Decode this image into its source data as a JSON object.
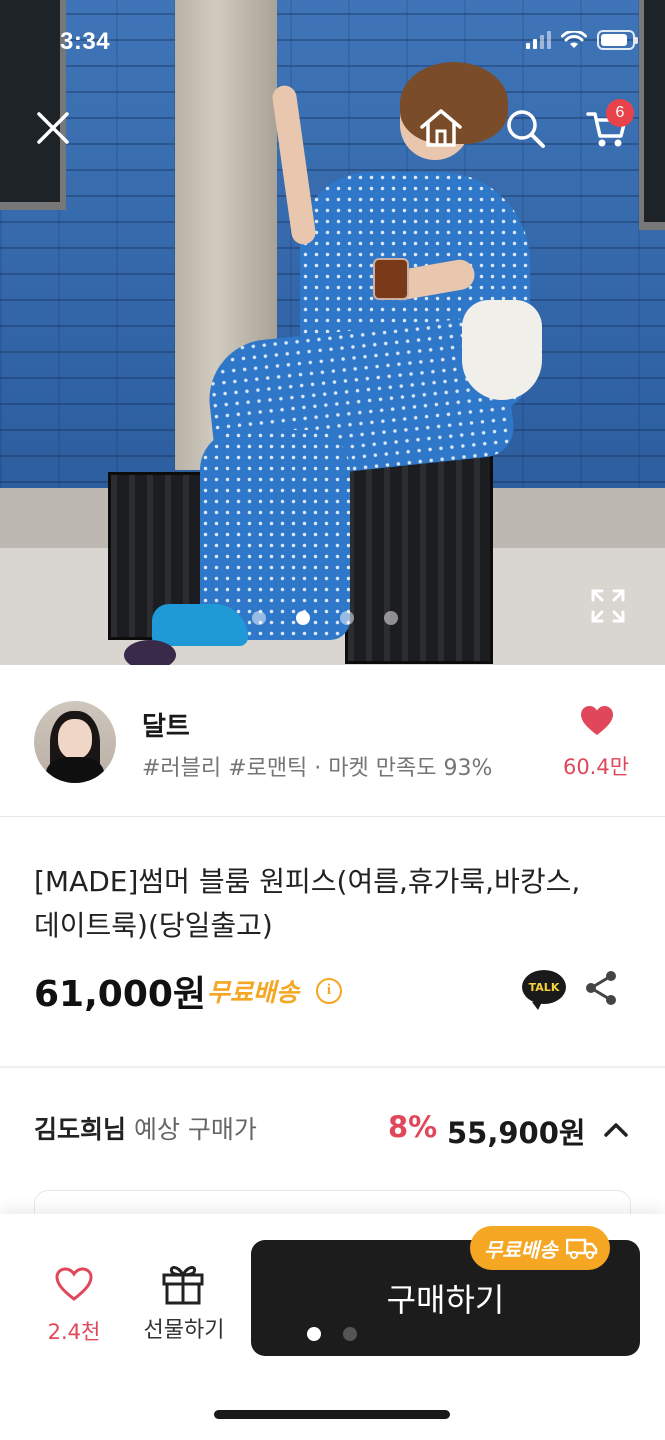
{
  "status_bar": {
    "time": "3:34"
  },
  "header": {
    "icons": [
      "close-icon",
      "home-icon",
      "search-icon",
      "cart-icon"
    ],
    "cart_badge": "6"
  },
  "gallery": {
    "slide_count": 4,
    "active_index": 1
  },
  "store": {
    "name": "달트",
    "tags": "#러블리 #로맨틱 · 마켓 만족도 93%",
    "like_count": "60.4만"
  },
  "product": {
    "title_line1": "[MADE]썸머 블룸 원피스(여름,휴가룩,바캉스,",
    "title_line2": "데이트룩)(당일출고)",
    "price": "61,000원",
    "shipping": "무료배송",
    "talk_label": "TALK"
  },
  "member_price": {
    "name": "김도희님",
    "label": " 예상 구매가",
    "discount": "8%",
    "price": "55,900원"
  },
  "bottom_bar": {
    "wish_count": "2.4천",
    "gift_label": "선물하기",
    "buy_label": "구매하기",
    "buy_tag": "무료배송",
    "page_dots": 2
  },
  "colors": {
    "accent": "#e0475a",
    "shipping": "#f5a623",
    "buy_bg": "#1c1c1c"
  }
}
